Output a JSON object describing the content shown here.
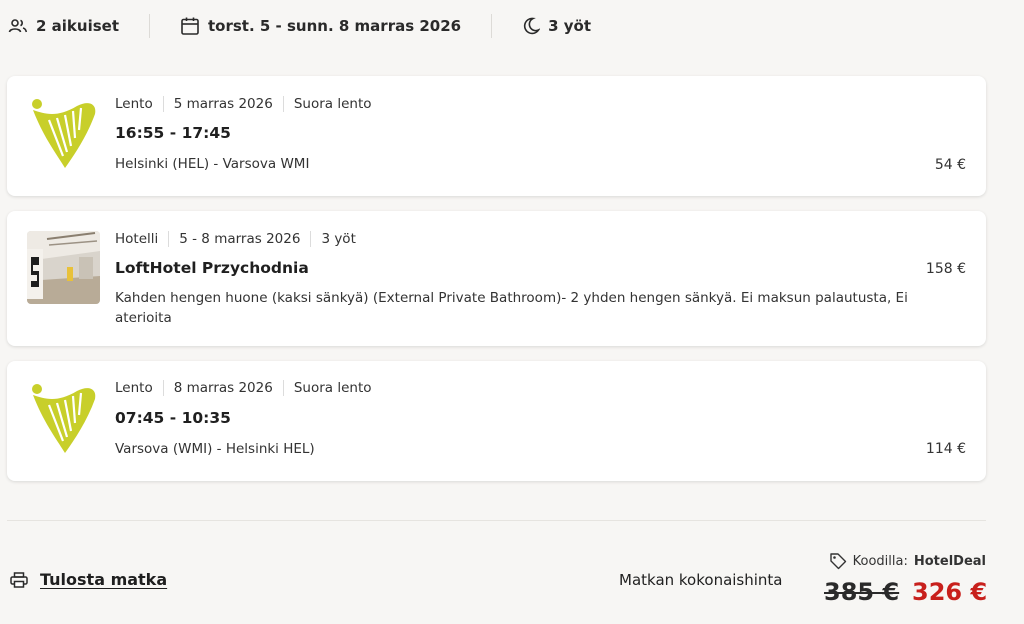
{
  "summary": {
    "travelers": "2 aikuiset",
    "dates": "torst. 5 - sunn. 8 marras 2026",
    "nights": "3 yöt"
  },
  "outbound": {
    "type": "Lento",
    "date": "5 marras 2026",
    "kind": "Suora lento",
    "time": "16:55 - 17:45",
    "route": "Helsinki (HEL) - Varsova WMI",
    "price": "54 €",
    "logo_icon": "harp-logo-icon"
  },
  "hotel": {
    "type": "Hotelli",
    "dates": "5 - 8 marras 2026",
    "nights": "3 yöt",
    "name": "LoftHotel Przychodnia",
    "description": "Kahden hengen huone (kaksi sänkyä) (External Private Bathroom)- 2 yhden hengen sänkyä. Ei maksun palautusta, Ei aterioita",
    "price": "158 €"
  },
  "inbound": {
    "type": "Lento",
    "date": "8 marras 2026",
    "kind": "Suora lento",
    "time": "07:45 - 10:35",
    "route": "Varsova (WMI) - Helsinki HEL)",
    "price": "114 €",
    "logo_icon": "harp-logo-icon"
  },
  "footer": {
    "print_label": "Tulosta matka",
    "total_label": "Matkan kokonaishinta",
    "code_label": "Koodilla:",
    "code_value": "HotelDeal",
    "old_price": "385 €",
    "new_price": "326 €"
  },
  "colors": {
    "accent_red": "#c8201c",
    "logo_yellow": "#c8cf2a"
  }
}
